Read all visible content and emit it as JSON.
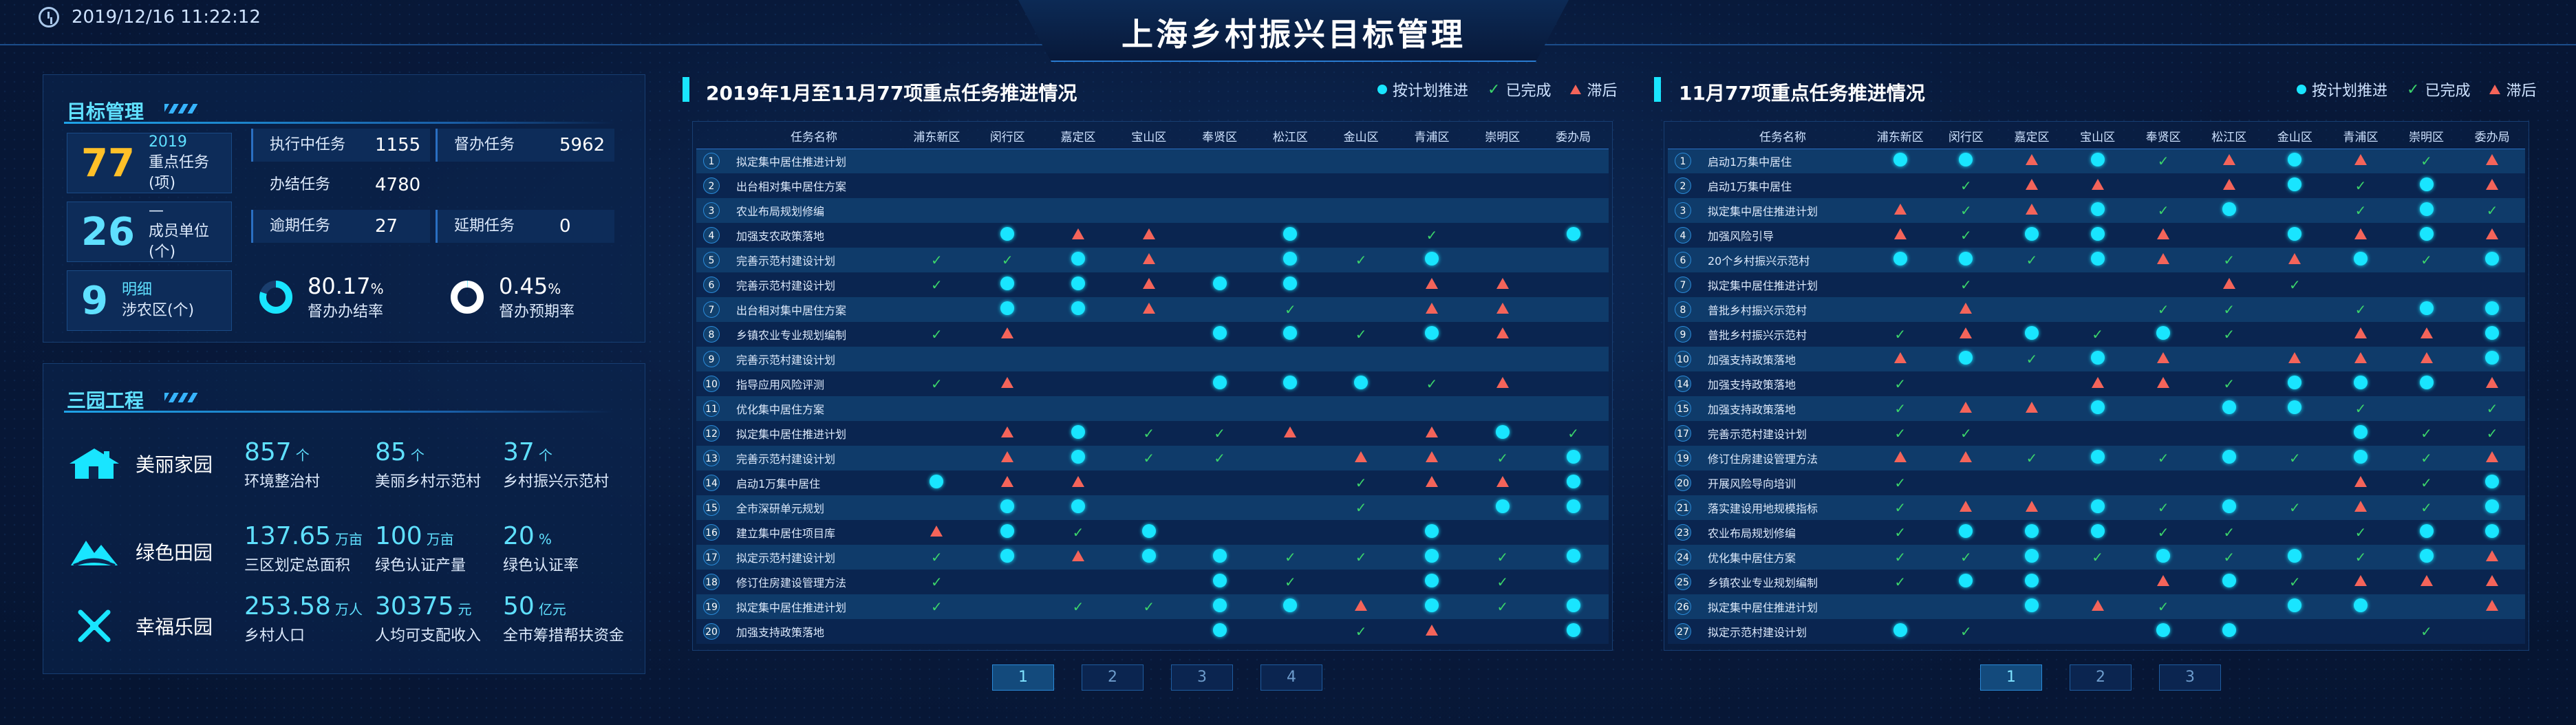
{
  "header": {
    "datetime": "2019/12/16 11:22:12",
    "title": "上海乡村振兴目标管理"
  },
  "goal": {
    "section_title": "目标管理",
    "boxes": [
      {
        "num": "77",
        "line1": "2019",
        "line2": "重点任务(项)",
        "color": "#ffc028"
      },
      {
        "num": "26",
        "line1": "—",
        "line2": "成员单位(个)",
        "color": "#5fe0ff"
      },
      {
        "num": "9",
        "line1": "明细",
        "line2": "涉农区(个)",
        "color": "#5fe0ff"
      }
    ],
    "stats": [
      {
        "label": "执行中任务",
        "value": "1155"
      },
      {
        "label": "督办任务",
        "value": "5962"
      },
      {
        "label": "办结任务",
        "value": "4780"
      },
      {
        "label": "逾期任务",
        "value": "27"
      },
      {
        "label": "延期任务",
        "value": "0"
      }
    ],
    "rings": [
      {
        "value": "80.17",
        "unit": "%",
        "label": "督办办结率",
        "fraction": 0.8017
      },
      {
        "value": "0.45",
        "unit": "%",
        "label": "督办预期率",
        "fraction": 0.0045
      }
    ]
  },
  "parks": {
    "section_title": "三园工程",
    "rows": [
      {
        "icon": "home-icon",
        "name": "美丽家园",
        "stats": [
          {
            "value": "857",
            "unit": "个",
            "label": "环境整治村"
          },
          {
            "value": "85",
            "unit": "个",
            "label": "美丽乡村示范村"
          },
          {
            "value": "37",
            "unit": "个",
            "label": "乡村振兴示范村"
          }
        ]
      },
      {
        "icon": "field-icon",
        "name": "绿色田园",
        "stats": [
          {
            "value": "137.65",
            "unit": "万亩",
            "label": "三区划定总面积"
          },
          {
            "value": "100",
            "unit": "万亩",
            "label": "绿色认证产量"
          },
          {
            "value": "20",
            "unit": "%",
            "label": "绿色认证率"
          }
        ]
      },
      {
        "icon": "windmill-icon",
        "name": "幸福乐园",
        "stats": [
          {
            "value": "253.58",
            "unit": "万人",
            "label": "乡村人口"
          },
          {
            "value": "30375",
            "unit": "元",
            "label": "人均可支配收入"
          },
          {
            "value": "50",
            "unit": "亿元",
            "label": "全市筹措帮扶资金"
          }
        ]
      }
    ]
  },
  "legend": {
    "planned": "按计划推进",
    "done": "已完成",
    "late": "滞后"
  },
  "table1": {
    "title": "2019年1月至11月77项重点任务推进情况",
    "columns": [
      "任务名称",
      "浦东新区",
      "闵行区",
      "嘉定区",
      "宝山区",
      "奉贤区",
      "松江区",
      "金山区",
      "青浦区",
      "崇明区",
      "委办局"
    ],
    "rows": [
      {
        "no": "1",
        "name": "拟定集中居住推进计划",
        "s": "----------"
      },
      {
        "no": "2",
        "name": "出台相对集中居住方案",
        "s": "----------"
      },
      {
        "no": "3",
        "name": "农业布局规划修编",
        "s": "----------"
      },
      {
        "no": "4",
        "name": "加强支农政策落地",
        "s": "-ptt-p-c-p"
      },
      {
        "no": "5",
        "name": "完善示范村建设计划",
        "s": "ccpt-pcp--"
      },
      {
        "no": "6",
        "name": "完善示范村建设计划",
        "s": "cpptpp-tt-"
      },
      {
        "no": "7",
        "name": "出台相对集中居住方案",
        "s": "-ppt-c-tt-"
      },
      {
        "no": "8",
        "name": "乡镇农业专业规划编制",
        "s": "ct--ppcpt-"
      },
      {
        "no": "9",
        "name": "完善示范村建设计划",
        "s": "----------"
      },
      {
        "no": "10",
        "name": "指导应用风险评测",
        "s": "ct--pppct-"
      },
      {
        "no": "11",
        "name": "优化集中居住方案",
        "s": "----------"
      },
      {
        "no": "12",
        "name": "拟定集中居住推进计划",
        "s": "-tpcct-tpc"
      },
      {
        "no": "13",
        "name": "完善示范村建设计划",
        "s": "-tpcc-ttcp"
      },
      {
        "no": "14",
        "name": "启动1万集中居住",
        "s": "ptt---cttp"
      },
      {
        "no": "15",
        "name": "全市深研单元规划",
        "s": "-pp---c-pp"
      },
      {
        "no": "16",
        "name": "建立集中居住项目库",
        "s": "tpcp---p--"
      },
      {
        "no": "17",
        "name": "拟定示范村建设计划",
        "s": "cptppccpcp"
      },
      {
        "no": "18",
        "name": "修订住房建设管理方法",
        "s": "c---pc-pc-"
      },
      {
        "no": "19",
        "name": "拟定集中居住推进计划",
        "s": "c-ccpptpcp"
      },
      {
        "no": "20",
        "name": "加强支持政策落地",
        "s": "----p-ct-p"
      }
    ],
    "pages": [
      "1",
      "2",
      "3",
      "4"
    ]
  },
  "table2": {
    "title": "11月77项重点任务推进情况",
    "columns": [
      "任务名称",
      "浦东新区",
      "闵行区",
      "嘉定区",
      "宝山区",
      "奉贤区",
      "松江区",
      "金山区",
      "青浦区",
      "崇明区",
      "委办局"
    ],
    "rows": [
      {
        "no": "1",
        "name": "启动1万集中居住",
        "s": "pptpctptct"
      },
      {
        "no": "2",
        "name": "启动1万集中居住",
        "s": "-ctt-tpcpt"
      },
      {
        "no": "3",
        "name": "拟定集中居住推进计划",
        "s": "tctpcp-cpc"
      },
      {
        "no": "4",
        "name": "加强风险引导",
        "s": "tcppt-ptpt"
      },
      {
        "no": "6",
        "name": "20个乡村振兴示范村",
        "s": "ppcptctpcp"
      },
      {
        "no": "7",
        "name": "拟定集中居住推进计划",
        "s": "-c---tc---"
      },
      {
        "no": "8",
        "name": "普批乡村振兴示范村",
        "s": "-t--cc-cpp"
      },
      {
        "no": "9",
        "name": "普批乡村振兴示范村",
        "s": "ctpcpc-ttp"
      },
      {
        "no": "10",
        "name": "加强支持政策落地",
        "s": "tpcpt-tttp"
      },
      {
        "no": "14",
        "name": "加强支持政策落地",
        "s": "c--ttcpppt"
      },
      {
        "no": "15",
        "name": "加强支持政策落地",
        "s": "cttp-ppc-c"
      },
      {
        "no": "17",
        "name": "完善示范村建设计划",
        "s": "cc-----pcc"
      },
      {
        "no": "19",
        "name": "修订住房建设管理方法",
        "s": "ttcpcpcpct"
      },
      {
        "no": "20",
        "name": "开展风险导向培训",
        "s": "c------tcp"
      },
      {
        "no": "21",
        "name": "落实建设用地规模指标",
        "s": "cttpcpctcp"
      },
      {
        "no": "23",
        "name": "农业布局规划修编",
        "s": "cpppcc-cpp"
      },
      {
        "no": "24",
        "name": "优化集中居住方案",
        "s": "ccpcpcpcpt"
      },
      {
        "no": "25",
        "name": "乡镇农业专业规划编制",
        "s": "cpp-tpcttt"
      },
      {
        "no": "26",
        "name": "拟定集中居住推进计划",
        "s": "--ptc-pp-t"
      },
      {
        "no": "27",
        "name": "拟定示范村建设计划",
        "s": "pc--pp--c-"
      }
    ],
    "pages": [
      "1",
      "2",
      "3"
    ]
  }
}
